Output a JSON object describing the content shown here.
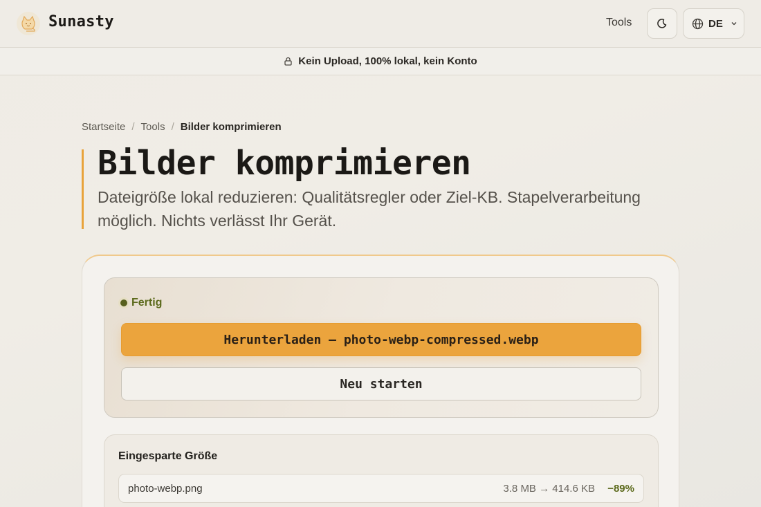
{
  "header": {
    "brand": "Sunasty",
    "nav_tools": "Tools",
    "language": "DE",
    "logo_icon": "cat-logo-icon",
    "theme_icon": "moon-icon",
    "language_icon": "globe-icon"
  },
  "banner": {
    "text": "Kein Upload, 100% lokal, kein Konto",
    "icon": "lock-icon"
  },
  "breadcrumb": {
    "items": [
      "Startseite",
      "Tools",
      "Bilder komprimieren"
    ],
    "separator": "/"
  },
  "page": {
    "title": "Bilder komprimieren",
    "subtitle": "Dateigröße lokal reduzieren: Qualitätsregler oder Ziel-KB. Stapelverarbeitung möglich. Nichts verlässt Ihr Gerät."
  },
  "status": {
    "label": "Fertig",
    "download_label": "Herunterladen — photo-webp-compressed.webp",
    "restart_label": "Neu starten"
  },
  "savings": {
    "title": "Eingesparte Größe",
    "files": [
      {
        "name": "photo-webp.png",
        "sizes": "3.8 MB → 414.6 KB",
        "percent": "−89%"
      }
    ]
  },
  "colors": {
    "accent": "#eba43d",
    "success": "#5c6a1c",
    "background": "#efece6"
  }
}
